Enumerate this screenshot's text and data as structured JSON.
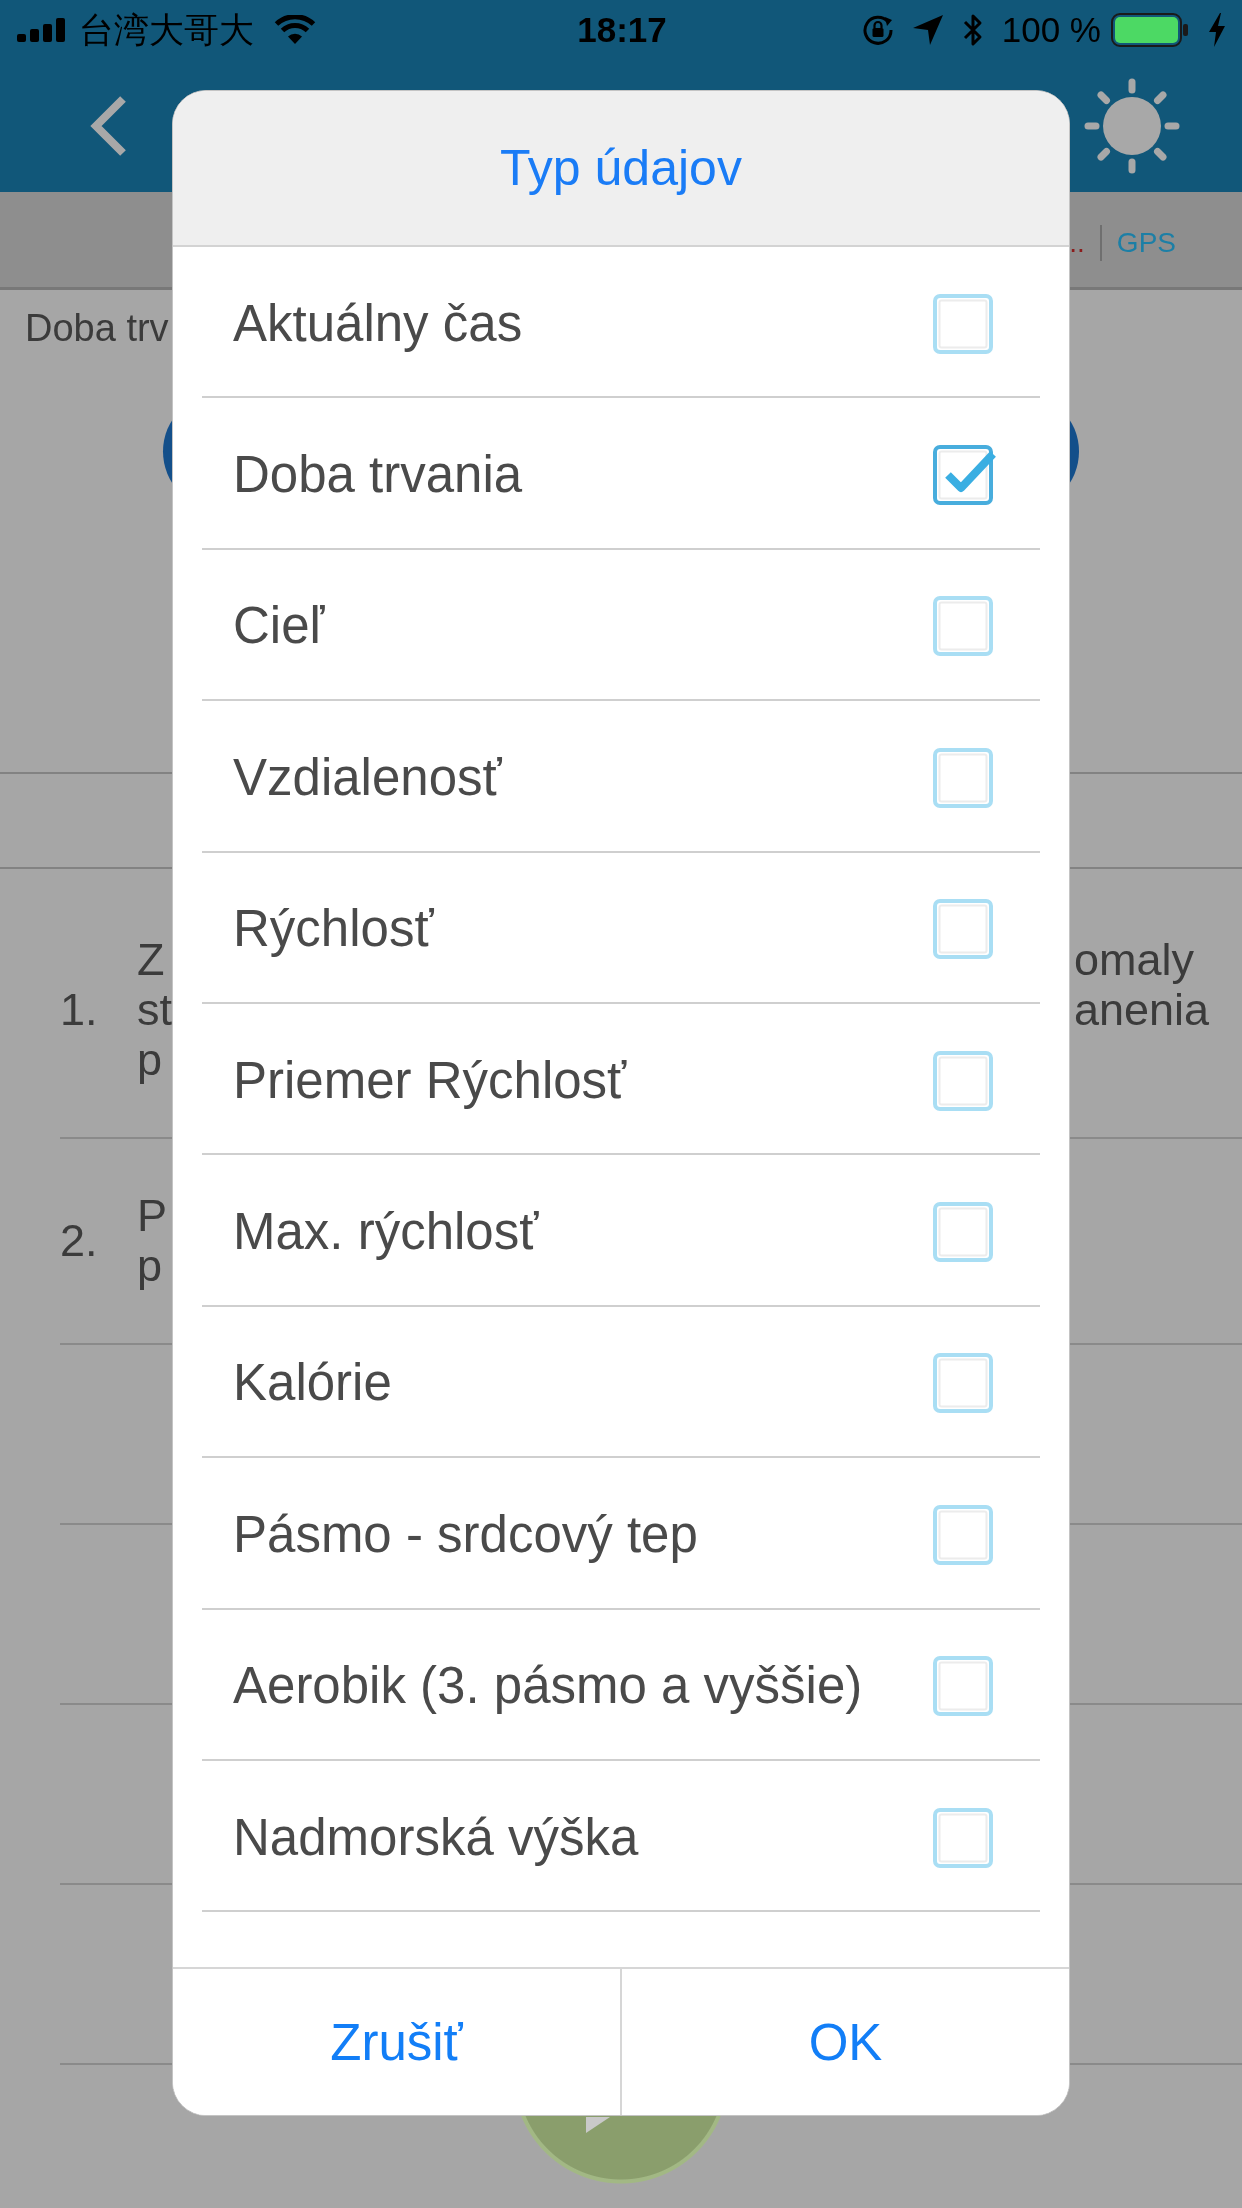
{
  "status_bar": {
    "carrier": "台湾大哥大",
    "time": "18:17",
    "battery": "100 %"
  },
  "tabs": [
    {
      "label": "..",
      "color": "#8b1c1c"
    },
    {
      "label": "GPS",
      "color": "#1c7fa6"
    }
  ],
  "summary": {
    "label": "Doba trv"
  },
  "list": [
    {
      "number": "1.",
      "lines": [
        {
          "start": "Z",
          "end": "omaly"
        },
        {
          "start": "st",
          "end": "anenia"
        },
        {
          "start": "p"
        }
      ]
    },
    {
      "number": "2.",
      "lines": [
        {
          "start": "P"
        },
        {
          "start": "p"
        }
      ]
    }
  ],
  "dialog": {
    "title": "Typ údajov",
    "options": [
      {
        "label": "Aktuálny čas",
        "checked": false
      },
      {
        "label": "Doba trvania",
        "checked": true
      },
      {
        "label": "Cieľ",
        "checked": false
      },
      {
        "label": "Vzdialenosť",
        "checked": false
      },
      {
        "label": "Rýchlosť",
        "checked": false
      },
      {
        "label": "Priemer Rýchlosť",
        "checked": false
      },
      {
        "label": "Max. rýchlosť",
        "checked": false
      },
      {
        "label": "Kalórie",
        "checked": false
      },
      {
        "label": "Pásmo - srdcový tep",
        "checked": false
      },
      {
        "label": "Aerobik (3. pásmo a vyššie)",
        "checked": false
      },
      {
        "label": "Nadmorská výška",
        "checked": false
      }
    ],
    "buttons": [
      "Zrušiť",
      "OK"
    ]
  }
}
